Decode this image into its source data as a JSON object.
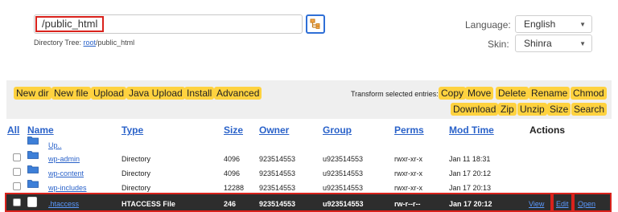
{
  "path": {
    "value": "/public_html"
  },
  "dir_tree": {
    "prefix": "Directory Tree:",
    "root_link": "root",
    "rest": "/public_html"
  },
  "settings": {
    "language_label": "Language:",
    "language_value": "English",
    "skin_label": "Skin:",
    "skin_value": "Shinra"
  },
  "toolbar": {
    "left_buttons": [
      "New dir",
      "New file",
      "Upload",
      "Java Upload",
      "Install",
      "Advanced"
    ],
    "transform_label": "Transform selected entries:",
    "right_buttons_row1": [
      "Copy",
      "Move",
      "Delete",
      "Rename",
      "Chmod"
    ],
    "right_buttons_row2": [
      "Download",
      "Zip",
      "Unzip",
      "Size",
      "Search"
    ]
  },
  "table": {
    "headers": {
      "all": "All",
      "name": "Name",
      "type": "Type",
      "size": "Size",
      "owner": "Owner",
      "group": "Group",
      "perms": "Perms",
      "mod_time": "Mod Time",
      "actions": "Actions"
    },
    "up_label": "Up..",
    "rows": [
      {
        "name": "wp-admin",
        "type": "Directory",
        "size": "4096",
        "owner": "923514553",
        "group": "u923514553",
        "perms": "rwxr-xr-x",
        "mod_time": "Jan 11 18:31"
      },
      {
        "name": "wp-content",
        "type": "Directory",
        "size": "4096",
        "owner": "923514553",
        "group": "u923514553",
        "perms": "rwxr-xr-x",
        "mod_time": "Jan 17 20:12"
      },
      {
        "name": "wp-includes",
        "type": "Directory",
        "size": "12288",
        "owner": "923514553",
        "group": "u923514553",
        "perms": "rwxr-xr-x",
        "mod_time": "Jan 17 20:13"
      }
    ],
    "selected_row": {
      "name": ".htaccess",
      "type": "HTACCESS File",
      "size": "246",
      "owner": "923514553",
      "group": "u923514553",
      "perms": "rw-r--r--",
      "mod_time": "Jan 17 20:12",
      "actions": {
        "view": "View",
        "edit": "Edit",
        "open": "Open"
      }
    }
  },
  "colors": {
    "button_yellow": "#ffd23f",
    "link_blue": "#2a62c9",
    "highlight_red": "#d9221c",
    "selected_row_bg": "#2d2d2d"
  },
  "icons": {
    "tree_button": "directory-tree-icon",
    "folder": "folder-icon"
  }
}
